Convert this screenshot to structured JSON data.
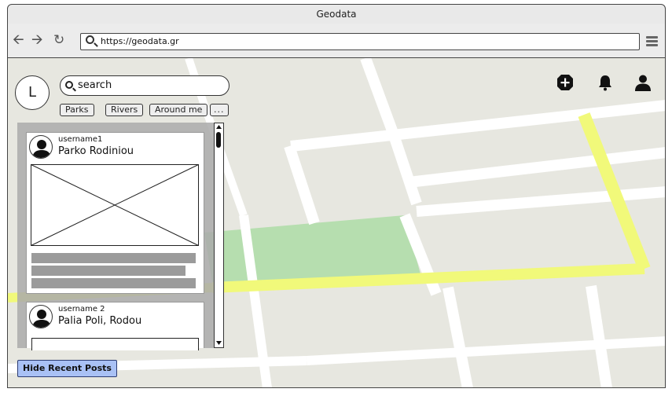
{
  "window": {
    "title": "Geodata"
  },
  "browser": {
    "back_icon": "arrow-left-icon",
    "forward_icon": "arrow-right-icon",
    "reload_icon": "reload-icon",
    "url": "https://geodata.gr",
    "menu_icon": "hamburger-menu-icon"
  },
  "app": {
    "user_initial": "L",
    "search": {
      "value": "search"
    },
    "filters": [
      "Parks",
      "Rivers",
      "Around me",
      "..."
    ],
    "top_icons": [
      "add-icon",
      "bell-icon",
      "user-icon"
    ],
    "posts": [
      {
        "username": "username1",
        "place": "Parko Rodiniou"
      },
      {
        "username": "username 2",
        "place": "Palia Poli, Rodou"
      }
    ],
    "hide_button": "Hide Recent Posts"
  }
}
